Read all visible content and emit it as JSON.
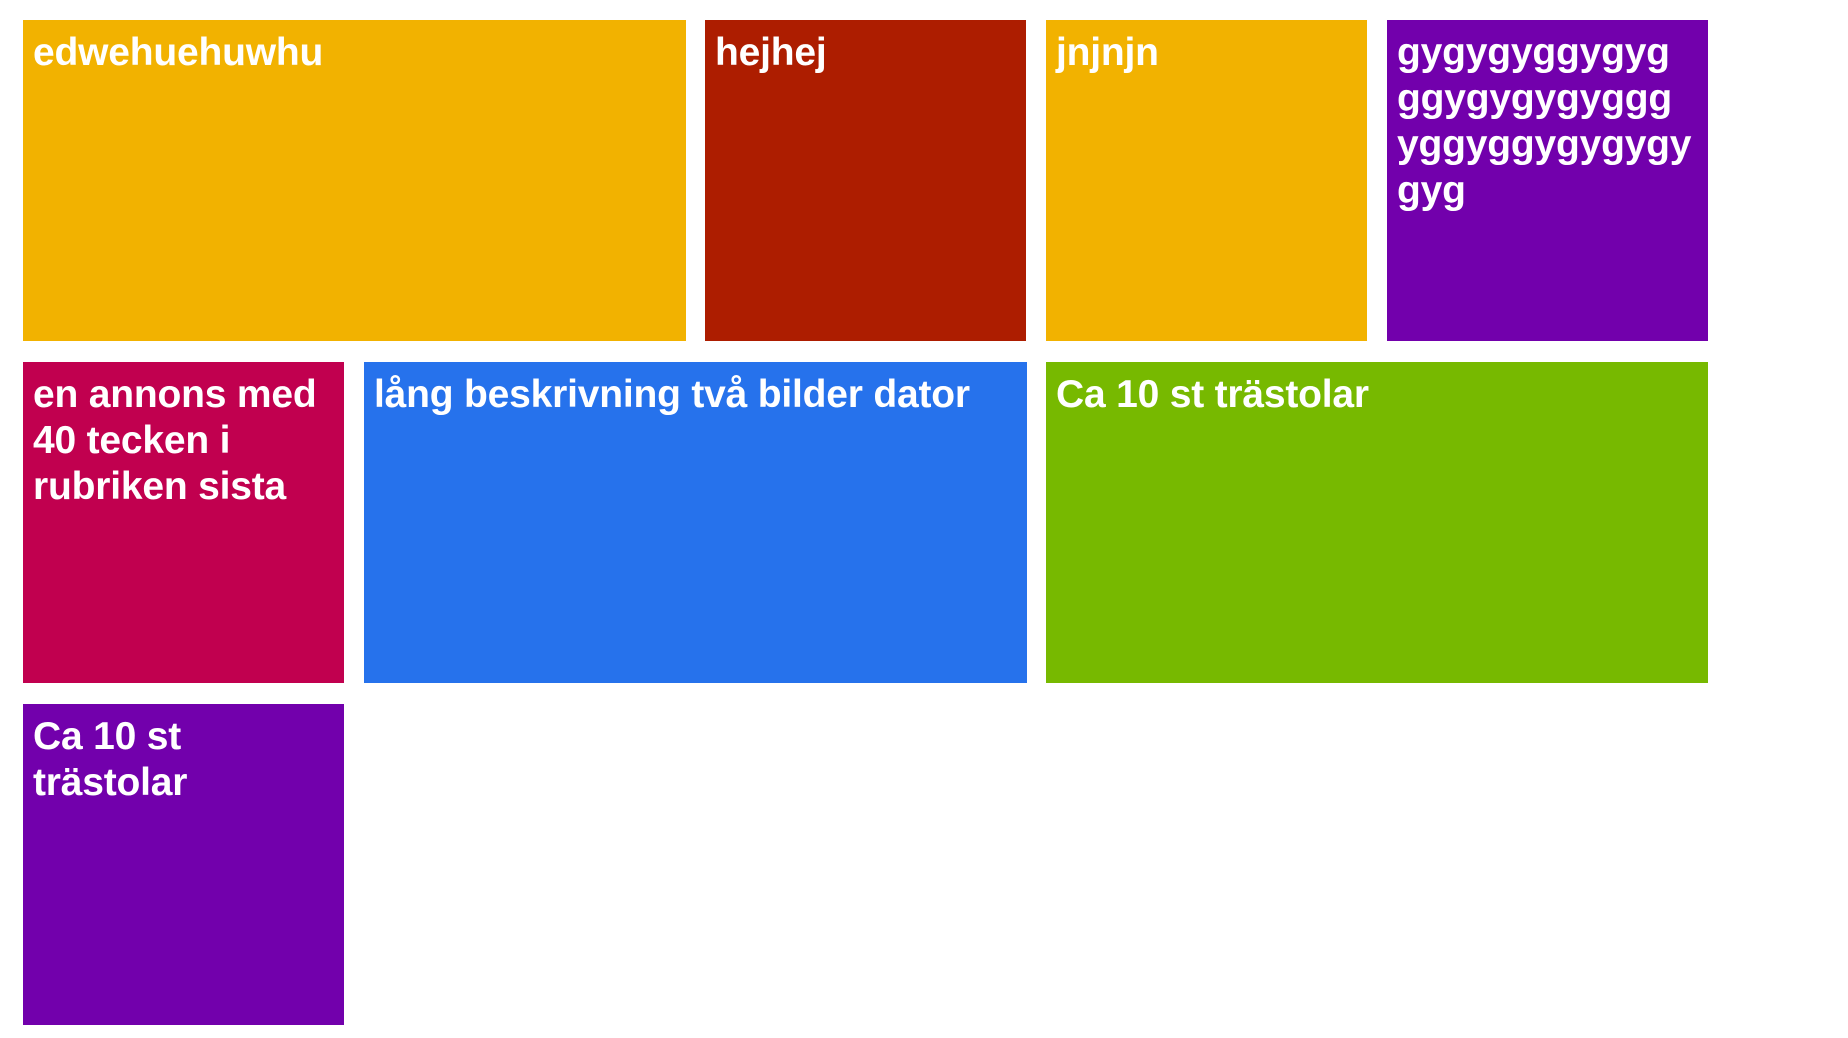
{
  "tiles": [
    {
      "title": "edwehuehuwhu",
      "color": "#f2b200"
    },
    {
      "title": "hejhej",
      "color": "#ad1d00"
    },
    {
      "title": "jnjnjn",
      "color": "#f2b200"
    },
    {
      "title": "gygygyggygyg ggygygygyggg yggyggygygygy gyg",
      "color": "#7200ac"
    },
    {
      "title": "en annons med 40 tecken i rubriken sista",
      "color": "#c1004f"
    },
    {
      "title": "lång beskrivning två bilder dator",
      "color": "#2672ec"
    },
    {
      "title": "Ca 10 st trästolar",
      "color": "#77b900"
    },
    {
      "title": "Ca 10 st trästolar",
      "color": "#7200ac"
    }
  ]
}
